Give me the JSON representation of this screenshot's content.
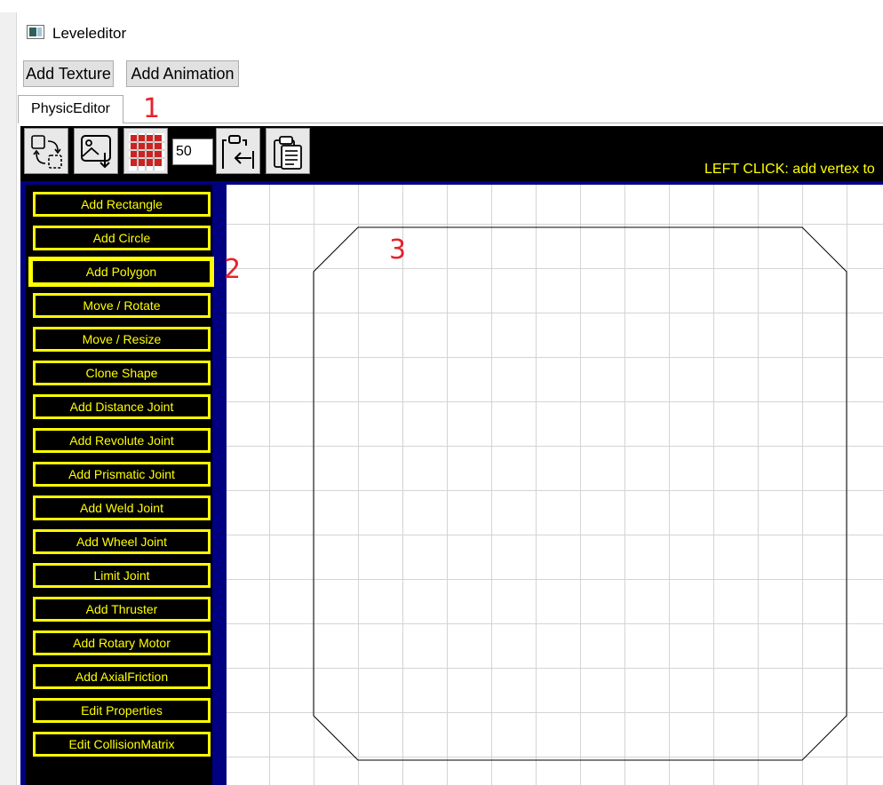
{
  "window": {
    "title": "Leveleditor"
  },
  "top_buttons": {
    "add_texture": "Add Texture",
    "add_animation": "Add Animation"
  },
  "tab": {
    "label": "PhysicEditor"
  },
  "annotations": {
    "one": "1",
    "two": "2",
    "three": "3"
  },
  "toolbar": {
    "grid_size_value": "50",
    "hint": "LEFT CLICK: add vertex to",
    "icons": [
      "transform-shapes-icon",
      "load-image-icon",
      "sprite-grid-icon",
      "paste-from-clipboard-icon",
      "clipboard-icon"
    ]
  },
  "sidebar": {
    "buttons": [
      "Add Rectangle",
      "Add Circle",
      "Add Polygon",
      "Move / Rotate",
      "Move / Resize",
      "Clone Shape",
      "Add Distance Joint",
      "Add Revolute Joint",
      "Add Prismatic Joint",
      "Add Weld Joint",
      "Add Wheel Joint",
      "Limit Joint",
      "Add Thruster",
      "Add Rotary Motor",
      "Add AxialFriction",
      "Edit Properties",
      "Edit CollisionMatrix"
    ],
    "active_index": 2
  },
  "colors": {
    "toolbar_bg": "#000000",
    "panel_border": "#000080",
    "button_text": "#ffff00",
    "hint_text": "#ffff00",
    "annotation": "#e8212c"
  }
}
